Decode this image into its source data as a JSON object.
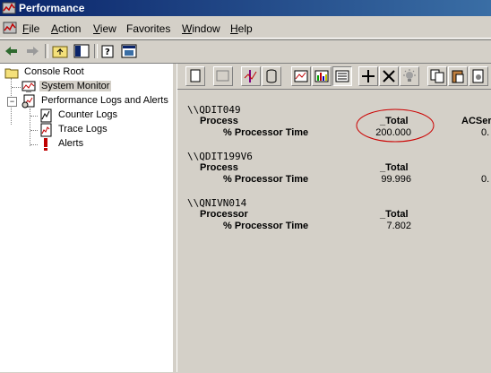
{
  "window": {
    "title": "Performance"
  },
  "menu": {
    "items": [
      {
        "label": "File",
        "mnemonic": "F",
        "rest": "ile"
      },
      {
        "label": "Action",
        "mnemonic": "A",
        "rest": "ction"
      },
      {
        "label": "View",
        "mnemonic": "V",
        "rest": "iew"
      },
      {
        "label": "Favorites",
        "mnemonic": "",
        "rest": "Favorites"
      },
      {
        "label": "Window",
        "mnemonic": "W",
        "rest": "indow"
      },
      {
        "label": "Help",
        "mnemonic": "H",
        "rest": "elp"
      }
    ]
  },
  "tree": {
    "console_root": "Console Root",
    "system_monitor": "System Monitor",
    "perf_logs": "Performance Logs and Alerts",
    "counter_logs": "Counter Logs",
    "trace_logs": "Trace Logs",
    "alerts": "Alerts"
  },
  "report": {
    "machines": [
      {
        "name": "\\\\QDIT049",
        "object": "Process",
        "instance": "_Total",
        "counter": "% Processor Time",
        "value": "200.000",
        "extra_instance": "ACSer",
        "extra_value": "0."
      },
      {
        "name": "\\\\QDIT199V6",
        "object": "Process",
        "instance": "_Total",
        "counter": "% Processor Time",
        "value": "99.996",
        "extra_value": "0."
      },
      {
        "name": "\\\\QNIVN014",
        "object": "Processor",
        "instance": "_Total",
        "counter": "% Processor Time",
        "value": "7.802"
      }
    ]
  },
  "colors": {
    "title_start": "#0a246a",
    "title_end": "#3a6ea5",
    "highlight_circle": "#cc0000"
  }
}
